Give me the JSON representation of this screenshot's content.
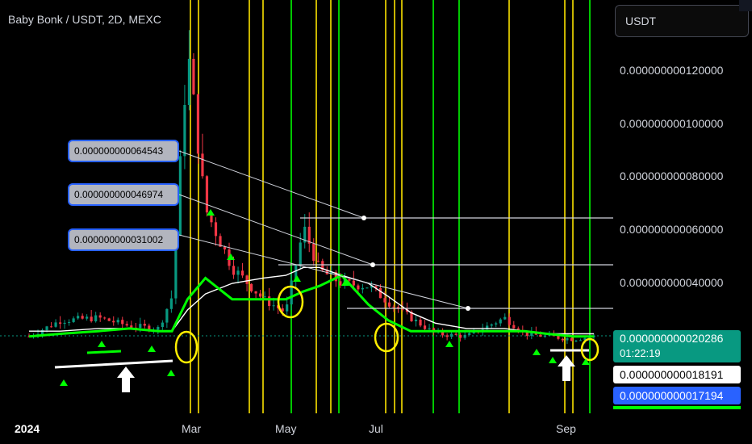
{
  "header": {
    "title": "Baby Bonk / USDT, 2D, MEXC",
    "currency": "USDT"
  },
  "y_ticks": [
    "0.000000000120000",
    "0.000000000100000",
    "0.000000000080000",
    "0.000000000060000",
    "0.000000000040000"
  ],
  "x_ticks": [
    "2024",
    "Mar",
    "May",
    "Jul",
    "Sep"
  ],
  "price_labels": {
    "last_price": "0.000000000020286",
    "countdown": "01:22:19",
    "white_level": "0.000000000018191",
    "blue_level": "0.000000000017194"
  },
  "callouts": [
    "0.000000000064543",
    "0.000000000046974",
    "0.000000000031002"
  ],
  "colors": {
    "background": "#000000",
    "up": "#089981",
    "down": "#f23645",
    "green_line": "#00ff00",
    "vertical_yellow": "#c8b400",
    "vertical_green": "#00c800"
  },
  "chart_data": {
    "type": "line",
    "pair": "Baby Bonk / USDT",
    "timeframe": "2D",
    "exchange": "MEXC",
    "ylim": [
      6e-12,
      1.38e-10
    ],
    "x": [
      "2024-01-01",
      "2024-01-15",
      "2024-02-01",
      "2024-02-15",
      "2024-02-28",
      "2024-03-05",
      "2024-03-12",
      "2024-03-20",
      "2024-04-01",
      "2024-04-15",
      "2024-04-25",
      "2024-05-03",
      "2024-05-10",
      "2024-05-20",
      "2024-06-01",
      "2024-06-10",
      "2024-06-20",
      "2024-07-01",
      "2024-07-15",
      "2024-08-01",
      "2024-08-10",
      "2024-08-20",
      "2024-09-01",
      "2024-09-10"
    ],
    "series": [
      {
        "values": [
          2e-11,
          2.6e-11,
          2.7e-11,
          2.4e-11,
          2.3e-11,
          3.5e-11,
          1.28e-10,
          6.8e-11,
          4.6e-11,
          3.4e-11,
          2.9e-11,
          6.1e-11,
          4.5e-11,
          4e-11,
          3.9e-11,
          3.3e-11,
          2.7e-11,
          2.1e-11,
          2e-11,
          2.7e-11,
          2.1e-11,
          2e-11,
          1.9e-11,
          2e-11
        ]
      },
      {
        "values": [
          2.2e-11,
          2.2e-11,
          2.3e-11,
          2.3e-11,
          2.2e-11,
          2.2e-11,
          3e-11,
          3.6e-11,
          4e-11,
          4.2e-11,
          4.3e-11,
          4.6e-11,
          4.6e-11,
          4.3e-11,
          4e-11,
          3.5e-11,
          2.9e-11,
          2.5e-11,
          2.3e-11,
          2.3e-11,
          2.2e-11,
          2.1e-11,
          2.1e-11,
          2.1e-11
        ]
      },
      {
        "values": [
          2e-11,
          2.1e-11,
          2.2e-11,
          2.3e-11,
          2.2e-11,
          2.2e-11,
          3.4e-11,
          4.2e-11,
          3.4e-11,
          3.4e-11,
          3.4e-11,
          3.7e-11,
          3.9e-11,
          4.3e-11,
          3.2e-11,
          2.6e-11,
          2.2e-11,
          2.2e-11,
          2.2e-11,
          2.2e-11,
          2.2e-11,
          2.1e-11,
          2e-11,
          2e-11
        ]
      }
    ],
    "levels": [
      6.4543e-11,
      4.6974e-11,
      3.1002e-11,
      1.8191e-11,
      1.7194e-11
    ],
    "grid": false,
    "legend": "none"
  }
}
